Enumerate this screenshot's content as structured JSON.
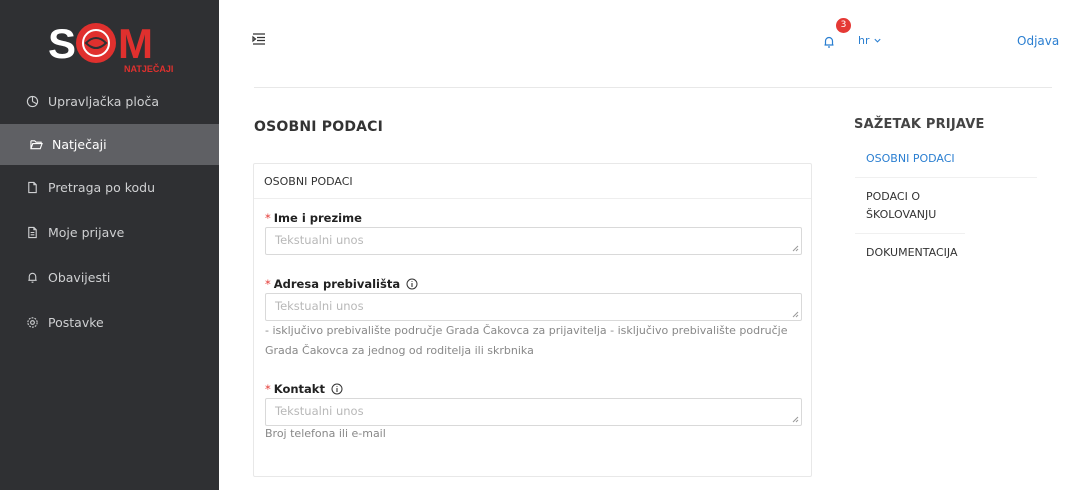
{
  "logo": {
    "brand": "SOM",
    "subtitle": "NATJEČAJI"
  },
  "sidebar": {
    "items": [
      {
        "label": "Upravljačka ploča",
        "icon": "dashboard-icon"
      },
      {
        "label": "Natječaji",
        "icon": "folder-open-icon",
        "active": true
      },
      {
        "label": "Pretraga po kodu",
        "icon": "document-icon"
      },
      {
        "label": "Moje prijave",
        "icon": "document-icon"
      },
      {
        "label": "Obavijesti",
        "icon": "bell-icon"
      },
      {
        "label": "Postavke",
        "icon": "gear-icon"
      }
    ]
  },
  "header": {
    "notification_count": "3",
    "language": "hr",
    "logout_label": "Odjava"
  },
  "main": {
    "section_title": "OSOBNI PODACI",
    "card_title": "OSOBNI PODACI",
    "fields": [
      {
        "label": "Ime i prezime",
        "placeholder": "Tekstualni unos",
        "help": ""
      },
      {
        "label": "Adresa prebivališta",
        "placeholder": "Tekstualni unos",
        "help": "- isključivo prebivalište područje Grada Čakovca za prijavitelja - isključivo prebivalište područje Grada Čakovca za jednog od roditelja ili skrbnika"
      },
      {
        "label": "Kontakt",
        "placeholder": "Tekstualni unos",
        "help": "Broj telefona ili e-mail"
      }
    ]
  },
  "summary": {
    "title": "SAŽETAK PRIJAVE",
    "items": [
      {
        "label": "OSOBNI PODACI",
        "active": true
      },
      {
        "label": "PODACI O ŠKOLOVANJU"
      },
      {
        "label": "DOKUMENTACIJA"
      }
    ]
  },
  "colors": {
    "accent": "#2b7fd1",
    "sidebar_bg": "#2f3033",
    "active_bg": "#5f6064",
    "required": "#e53935"
  }
}
